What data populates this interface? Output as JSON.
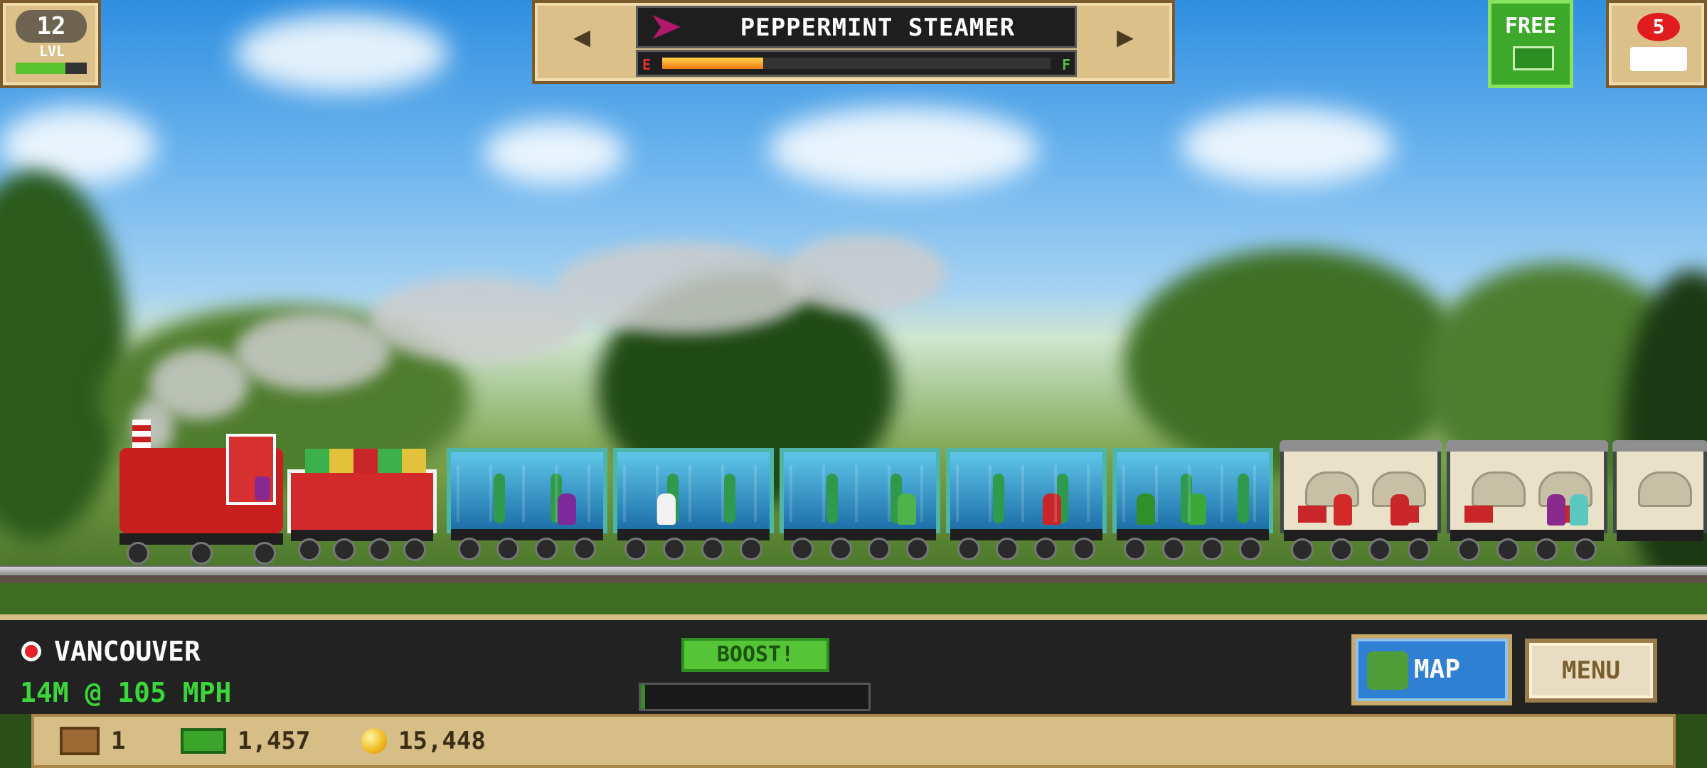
{
  "level": {
    "number": "12",
    "label": "LVL",
    "progress": 0.7
  },
  "train": {
    "name": "PEPPERMINT STEAMER",
    "fuel_empty_label": "E",
    "fuel_full_label": "F",
    "fuel_level": 0.26
  },
  "buttons": {
    "prev_arrow": "◀",
    "next_arrow": "▶",
    "free_label": "FREE",
    "trains_count": "5",
    "boost_label": "BOOST!",
    "map_label": "MAP",
    "menu_label": "MENU"
  },
  "status": {
    "location": "VANCOUVER",
    "speed": "14M @ 105 MPH",
    "boost_progress": 0.02
  },
  "currency": {
    "crates": "1",
    "cash": "1,457",
    "coins": "15,448"
  },
  "colors": {
    "fuel": "#f07a12",
    "speed_text": "#3bd63a",
    "free_button": "#3ea82b",
    "map_button": "#2f7fd2"
  },
  "icons": [
    "lvl-badge",
    "triangle-left-icon",
    "triangle-right-icon",
    "train-icon",
    "ticket-icon",
    "red-dot-icon",
    "globe-icon",
    "crate-icon",
    "cash-icon",
    "coin-icon"
  ]
}
